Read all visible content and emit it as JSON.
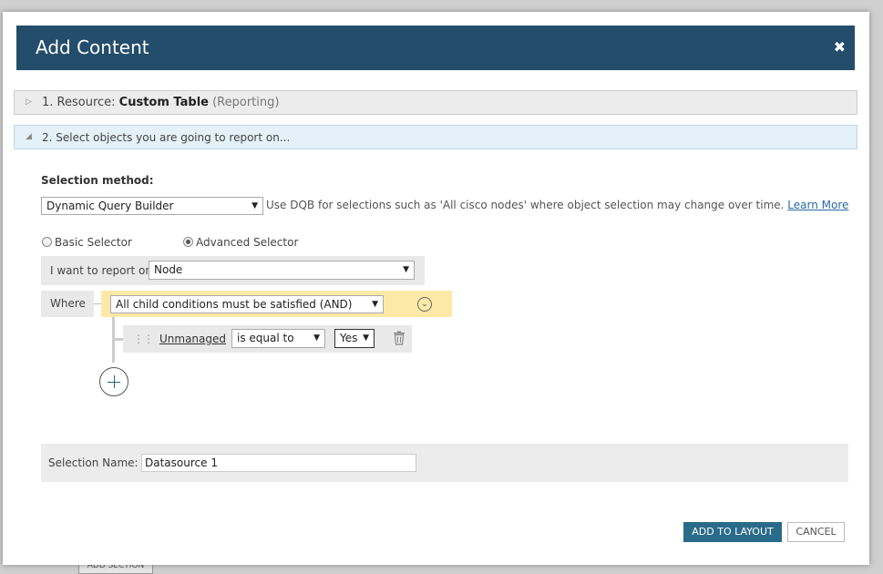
{
  "modal": {
    "title": "Add Content",
    "close_glyph": "✖"
  },
  "steps": [
    {
      "arrow": "▷",
      "prefix": "1. Resource: ",
      "name": "Custom Table",
      "suffix": "(Reporting)"
    },
    {
      "arrow": "◢",
      "text": "2. Select objects you are going to report on..."
    }
  ],
  "selection": {
    "label": "Selection method:",
    "method": "Dynamic Query Builder",
    "description": "Use DQB for selections such as 'All cisco nodes' where object selection may change over time.",
    "learn_more": "Learn More"
  },
  "selectors": {
    "basic": "Basic Selector",
    "advanced": "Advanced Selector",
    "selected": "advanced"
  },
  "report": {
    "label": "I want to report on",
    "value": "Node"
  },
  "where": {
    "label": "Where",
    "condition": "All child conditions must be satisfied (AND)",
    "rule": {
      "field": "Unmanaged",
      "operator": "is equal to",
      "value": "Yes"
    }
  },
  "selection_name": {
    "label": "Selection Name:",
    "value": "Datasource 1"
  },
  "buttons": {
    "add": "ADD TO LAYOUT",
    "cancel": "CANCEL"
  },
  "background": {
    "add_section": "ADD SECTION"
  },
  "icons": {
    "close": "close-icon",
    "collapse": "chevron-down-circle-icon",
    "add": "plus-circle-icon",
    "delete": "trash-icon",
    "drag": "drag-handle-icon"
  },
  "colors": {
    "header": "#234d6b",
    "primary_button": "#2b6b8a",
    "condition_bg": "#fde9a7",
    "step_active_bg": "#e4f1f8",
    "link": "#2a6aa0"
  }
}
